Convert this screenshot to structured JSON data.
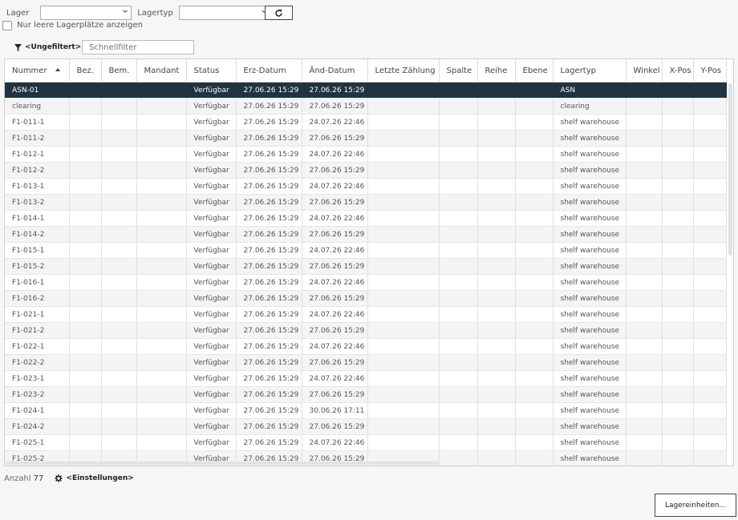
{
  "toolbar": {
    "lager_label": "Lager",
    "lager_value": "",
    "lagertyp_label": "Lagertyp",
    "lagertyp_value": "",
    "refresh_icon": "refresh-icon",
    "empty_only_label": "Nur leere Lagerplätze anzeigen"
  },
  "filter": {
    "filter_icon": "funnel-icon",
    "filter_label": "<Ungefiltert>",
    "quick_placeholder": "Schnellfilter"
  },
  "columns": [
    "Nummer",
    "Bez.",
    "Bem.",
    "Mandant",
    "Status",
    "Erz-Datum",
    "Änd-Datum",
    "Letzte Zählung",
    "Spalte",
    "Reihe",
    "Ebene",
    "Lagertyp",
    "Winkel",
    "X-Pos",
    "Y-Pos"
  ],
  "rows": [
    {
      "nummer": "ASN-01",
      "status": "Verfügbar",
      "erz": "27.06.26 15:29",
      "aend": "27.06.26 15:29",
      "lagertyp": "ASN"
    },
    {
      "nummer": "clearing",
      "status": "Verfügbar",
      "erz": "27.06.26 15:29",
      "aend": "27.06.26 15:29",
      "lagertyp": "clearing"
    },
    {
      "nummer": "F1-011-1",
      "status": "Verfügbar",
      "erz": "27.06.26 15:29",
      "aend": "24.07.26 22:46",
      "lagertyp": "shelf warehouse"
    },
    {
      "nummer": "F1-011-2",
      "status": "Verfügbar",
      "erz": "27.06.26 15:29",
      "aend": "27.06.26 15:29",
      "lagertyp": "shelf warehouse"
    },
    {
      "nummer": "F1-012-1",
      "status": "Verfügbar",
      "erz": "27.06.26 15:29",
      "aend": "24.07.26 22:46",
      "lagertyp": "shelf warehouse"
    },
    {
      "nummer": "F1-012-2",
      "status": "Verfügbar",
      "erz": "27.06.26 15:29",
      "aend": "27.06.26 15:29",
      "lagertyp": "shelf warehouse"
    },
    {
      "nummer": "F1-013-1",
      "status": "Verfügbar",
      "erz": "27.06.26 15:29",
      "aend": "24.07.26 22:46",
      "lagertyp": "shelf warehouse"
    },
    {
      "nummer": "F1-013-2",
      "status": "Verfügbar",
      "erz": "27.06.26 15:29",
      "aend": "27.06.26 15:29",
      "lagertyp": "shelf warehouse"
    },
    {
      "nummer": "F1-014-1",
      "status": "Verfügbar",
      "erz": "27.06.26 15:29",
      "aend": "24.07.26 22:46",
      "lagertyp": "shelf warehouse"
    },
    {
      "nummer": "F1-014-2",
      "status": "Verfügbar",
      "erz": "27.06.26 15:29",
      "aend": "27.06.26 15:29",
      "lagertyp": "shelf warehouse"
    },
    {
      "nummer": "F1-015-1",
      "status": "Verfügbar",
      "erz": "27.06.26 15:29",
      "aend": "24.07.26 22:46",
      "lagertyp": "shelf warehouse"
    },
    {
      "nummer": "F1-015-2",
      "status": "Verfügbar",
      "erz": "27.06.26 15:29",
      "aend": "27.06.26 15:29",
      "lagertyp": "shelf warehouse"
    },
    {
      "nummer": "F1-016-1",
      "status": "Verfügbar",
      "erz": "27.06.26 15:29",
      "aend": "24.07.26 22:46",
      "lagertyp": "shelf warehouse"
    },
    {
      "nummer": "F1-016-2",
      "status": "Verfügbar",
      "erz": "27.06.26 15:29",
      "aend": "27.06.26 15:29",
      "lagertyp": "shelf warehouse"
    },
    {
      "nummer": "F1-021-1",
      "status": "Verfügbar",
      "erz": "27.06.26 15:29",
      "aend": "24.07.26 22:46",
      "lagertyp": "shelf warehouse"
    },
    {
      "nummer": "F1-021-2",
      "status": "Verfügbar",
      "erz": "27.06.26 15:29",
      "aend": "27.06.26 15:29",
      "lagertyp": "shelf warehouse"
    },
    {
      "nummer": "F1-022-1",
      "status": "Verfügbar",
      "erz": "27.06.26 15:29",
      "aend": "24.07.26 22:46",
      "lagertyp": "shelf warehouse"
    },
    {
      "nummer": "F1-022-2",
      "status": "Verfügbar",
      "erz": "27.06.26 15:29",
      "aend": "27.06.26 15:29",
      "lagertyp": "shelf warehouse"
    },
    {
      "nummer": "F1-023-1",
      "status": "Verfügbar",
      "erz": "27.06.26 15:29",
      "aend": "24.07.26 22:46",
      "lagertyp": "shelf warehouse"
    },
    {
      "nummer": "F1-023-2",
      "status": "Verfügbar",
      "erz": "27.06.26 15:29",
      "aend": "27.06.26 15:29",
      "lagertyp": "shelf warehouse"
    },
    {
      "nummer": "F1-024-1",
      "status": "Verfügbar",
      "erz": "27.06.26 15:29",
      "aend": "30.06.26 17:11",
      "lagertyp": "shelf warehouse"
    },
    {
      "nummer": "F1-024-2",
      "status": "Verfügbar",
      "erz": "27.06.26 15:29",
      "aend": "27.06.26 15:29",
      "lagertyp": "shelf warehouse"
    },
    {
      "nummer": "F1-025-1",
      "status": "Verfügbar",
      "erz": "27.06.26 15:29",
      "aend": "24.07.26 22:46",
      "lagertyp": "shelf warehouse"
    },
    {
      "nummer": "F1-025-2",
      "status": "Verfügbar",
      "erz": "27.06.26 15:29",
      "aend": "27.06.26 15:29",
      "lagertyp": "shelf warehouse"
    }
  ],
  "selected_row": "ASN-01",
  "footer": {
    "count_label": "Anzahl",
    "count_value": "77",
    "settings_icon": "gear-icon",
    "settings_label": "<Einstellungen>"
  },
  "lagereinheiten_button": "Lagereinheiten...",
  "colors": {
    "selected_row_bg": "#1f3340",
    "background": "#f6f6f6"
  }
}
